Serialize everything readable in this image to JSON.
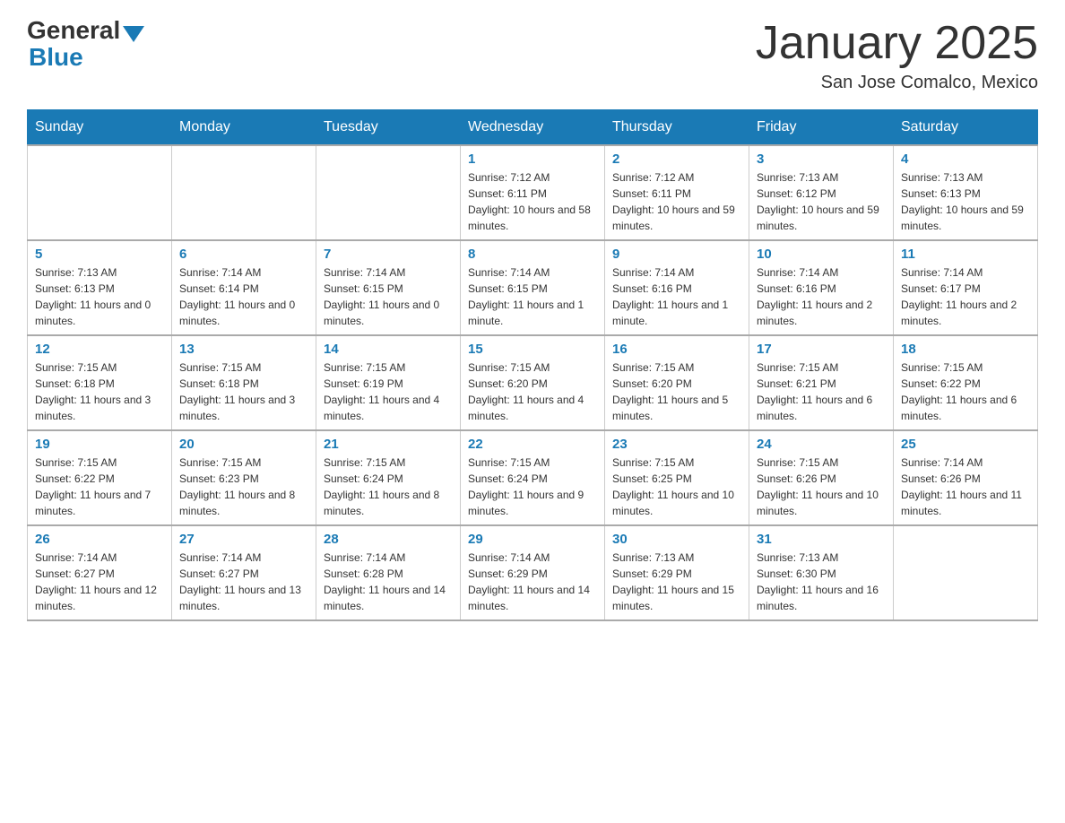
{
  "header": {
    "logo_general": "General",
    "logo_blue": "Blue",
    "month_year": "January 2025",
    "location": "San Jose Comalco, Mexico"
  },
  "calendar": {
    "days_of_week": [
      "Sunday",
      "Monday",
      "Tuesday",
      "Wednesday",
      "Thursday",
      "Friday",
      "Saturday"
    ],
    "weeks": [
      [
        {
          "day": "",
          "info": ""
        },
        {
          "day": "",
          "info": ""
        },
        {
          "day": "",
          "info": ""
        },
        {
          "day": "1",
          "info": "Sunrise: 7:12 AM\nSunset: 6:11 PM\nDaylight: 10 hours and 58 minutes."
        },
        {
          "day": "2",
          "info": "Sunrise: 7:12 AM\nSunset: 6:11 PM\nDaylight: 10 hours and 59 minutes."
        },
        {
          "day": "3",
          "info": "Sunrise: 7:13 AM\nSunset: 6:12 PM\nDaylight: 10 hours and 59 minutes."
        },
        {
          "day": "4",
          "info": "Sunrise: 7:13 AM\nSunset: 6:13 PM\nDaylight: 10 hours and 59 minutes."
        }
      ],
      [
        {
          "day": "5",
          "info": "Sunrise: 7:13 AM\nSunset: 6:13 PM\nDaylight: 11 hours and 0 minutes."
        },
        {
          "day": "6",
          "info": "Sunrise: 7:14 AM\nSunset: 6:14 PM\nDaylight: 11 hours and 0 minutes."
        },
        {
          "day": "7",
          "info": "Sunrise: 7:14 AM\nSunset: 6:15 PM\nDaylight: 11 hours and 0 minutes."
        },
        {
          "day": "8",
          "info": "Sunrise: 7:14 AM\nSunset: 6:15 PM\nDaylight: 11 hours and 1 minute."
        },
        {
          "day": "9",
          "info": "Sunrise: 7:14 AM\nSunset: 6:16 PM\nDaylight: 11 hours and 1 minute."
        },
        {
          "day": "10",
          "info": "Sunrise: 7:14 AM\nSunset: 6:16 PM\nDaylight: 11 hours and 2 minutes."
        },
        {
          "day": "11",
          "info": "Sunrise: 7:14 AM\nSunset: 6:17 PM\nDaylight: 11 hours and 2 minutes."
        }
      ],
      [
        {
          "day": "12",
          "info": "Sunrise: 7:15 AM\nSunset: 6:18 PM\nDaylight: 11 hours and 3 minutes."
        },
        {
          "day": "13",
          "info": "Sunrise: 7:15 AM\nSunset: 6:18 PM\nDaylight: 11 hours and 3 minutes."
        },
        {
          "day": "14",
          "info": "Sunrise: 7:15 AM\nSunset: 6:19 PM\nDaylight: 11 hours and 4 minutes."
        },
        {
          "day": "15",
          "info": "Sunrise: 7:15 AM\nSunset: 6:20 PM\nDaylight: 11 hours and 4 minutes."
        },
        {
          "day": "16",
          "info": "Sunrise: 7:15 AM\nSunset: 6:20 PM\nDaylight: 11 hours and 5 minutes."
        },
        {
          "day": "17",
          "info": "Sunrise: 7:15 AM\nSunset: 6:21 PM\nDaylight: 11 hours and 6 minutes."
        },
        {
          "day": "18",
          "info": "Sunrise: 7:15 AM\nSunset: 6:22 PM\nDaylight: 11 hours and 6 minutes."
        }
      ],
      [
        {
          "day": "19",
          "info": "Sunrise: 7:15 AM\nSunset: 6:22 PM\nDaylight: 11 hours and 7 minutes."
        },
        {
          "day": "20",
          "info": "Sunrise: 7:15 AM\nSunset: 6:23 PM\nDaylight: 11 hours and 8 minutes."
        },
        {
          "day": "21",
          "info": "Sunrise: 7:15 AM\nSunset: 6:24 PM\nDaylight: 11 hours and 8 minutes."
        },
        {
          "day": "22",
          "info": "Sunrise: 7:15 AM\nSunset: 6:24 PM\nDaylight: 11 hours and 9 minutes."
        },
        {
          "day": "23",
          "info": "Sunrise: 7:15 AM\nSunset: 6:25 PM\nDaylight: 11 hours and 10 minutes."
        },
        {
          "day": "24",
          "info": "Sunrise: 7:15 AM\nSunset: 6:26 PM\nDaylight: 11 hours and 10 minutes."
        },
        {
          "day": "25",
          "info": "Sunrise: 7:14 AM\nSunset: 6:26 PM\nDaylight: 11 hours and 11 minutes."
        }
      ],
      [
        {
          "day": "26",
          "info": "Sunrise: 7:14 AM\nSunset: 6:27 PM\nDaylight: 11 hours and 12 minutes."
        },
        {
          "day": "27",
          "info": "Sunrise: 7:14 AM\nSunset: 6:27 PM\nDaylight: 11 hours and 13 minutes."
        },
        {
          "day": "28",
          "info": "Sunrise: 7:14 AM\nSunset: 6:28 PM\nDaylight: 11 hours and 14 minutes."
        },
        {
          "day": "29",
          "info": "Sunrise: 7:14 AM\nSunset: 6:29 PM\nDaylight: 11 hours and 14 minutes."
        },
        {
          "day": "30",
          "info": "Sunrise: 7:13 AM\nSunset: 6:29 PM\nDaylight: 11 hours and 15 minutes."
        },
        {
          "day": "31",
          "info": "Sunrise: 7:13 AM\nSunset: 6:30 PM\nDaylight: 11 hours and 16 minutes."
        },
        {
          "day": "",
          "info": ""
        }
      ]
    ]
  }
}
